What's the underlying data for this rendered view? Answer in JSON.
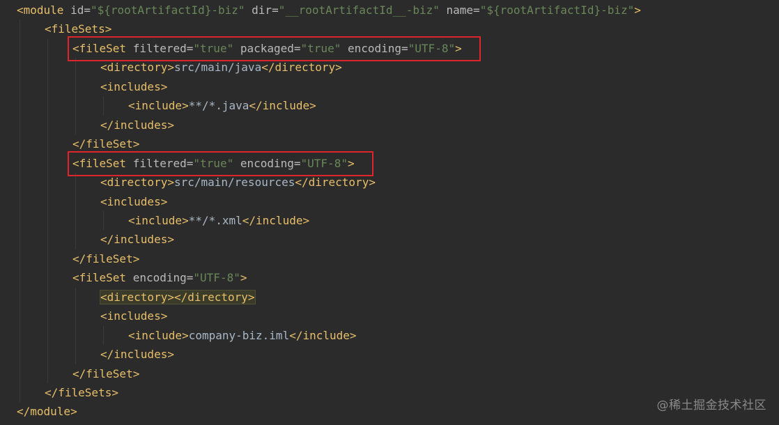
{
  "editor": {
    "lines": [
      {
        "indent": 0,
        "tokens": [
          {
            "t": "tag",
            "s": "<module "
          },
          {
            "t": "attr",
            "s": "id="
          },
          {
            "t": "val",
            "s": "\"${rootArtifactId}-biz\""
          },
          {
            "t": "attr",
            "s": " dir="
          },
          {
            "t": "val",
            "s": "\"__rootArtifactId__-biz\""
          },
          {
            "t": "attr",
            "s": " name="
          },
          {
            "t": "val",
            "s": "\"${rootArtifactId}-biz\""
          },
          {
            "t": "tag",
            "s": ">"
          }
        ]
      },
      {
        "indent": 1,
        "tokens": [
          {
            "t": "tag",
            "s": "<fileSets>"
          }
        ]
      },
      {
        "indent": 2,
        "tokens": [
          {
            "t": "tag",
            "s": "<fileSet "
          },
          {
            "t": "attr",
            "s": "filtered="
          },
          {
            "t": "val",
            "s": "\"true\""
          },
          {
            "t": "attr",
            "s": " packaged="
          },
          {
            "t": "val",
            "s": "\"true\""
          },
          {
            "t": "attr",
            "s": " encoding="
          },
          {
            "t": "val",
            "s": "\"UTF-8\""
          },
          {
            "t": "tag",
            "s": ">"
          }
        ]
      },
      {
        "indent": 3,
        "tokens": [
          {
            "t": "tag",
            "s": "<directory>"
          },
          {
            "t": "txt",
            "s": "src/main/java"
          },
          {
            "t": "tag",
            "s": "</directory>"
          }
        ]
      },
      {
        "indent": 3,
        "tokens": [
          {
            "t": "tag",
            "s": "<includes>"
          }
        ]
      },
      {
        "indent": 4,
        "tokens": [
          {
            "t": "tag",
            "s": "<include>"
          },
          {
            "t": "txt",
            "s": "**/*.java"
          },
          {
            "t": "tag",
            "s": "</include>"
          }
        ]
      },
      {
        "indent": 3,
        "tokens": [
          {
            "t": "tag",
            "s": "</includes>"
          }
        ]
      },
      {
        "indent": 2,
        "tokens": [
          {
            "t": "tag",
            "s": "</fileSet>"
          }
        ]
      },
      {
        "indent": 2,
        "tokens": [
          {
            "t": "tag",
            "s": "<fileSet "
          },
          {
            "t": "attr",
            "s": "filtered="
          },
          {
            "t": "val",
            "s": "\"true\""
          },
          {
            "t": "attr",
            "s": " encoding="
          },
          {
            "t": "val",
            "s": "\"UTF-8\""
          },
          {
            "t": "tag",
            "s": ">"
          }
        ]
      },
      {
        "indent": 3,
        "tokens": [
          {
            "t": "tag",
            "s": "<directory>"
          },
          {
            "t": "txt",
            "s": "src/main/resources"
          },
          {
            "t": "tag",
            "s": "</directory>"
          }
        ]
      },
      {
        "indent": 3,
        "tokens": [
          {
            "t": "tag",
            "s": "<includes>"
          }
        ]
      },
      {
        "indent": 4,
        "tokens": [
          {
            "t": "tag",
            "s": "<include>"
          },
          {
            "t": "txt",
            "s": "**/*.xml"
          },
          {
            "t": "tag",
            "s": "</include>"
          }
        ]
      },
      {
        "indent": 3,
        "tokens": [
          {
            "t": "tag",
            "s": "</includes>"
          }
        ]
      },
      {
        "indent": 2,
        "tokens": [
          {
            "t": "tag",
            "s": "</fileSet>"
          }
        ]
      },
      {
        "indent": 2,
        "tokens": [
          {
            "t": "tag",
            "s": "<fileSet "
          },
          {
            "t": "attr",
            "s": "encoding="
          },
          {
            "t": "val",
            "s": "\"UTF-8\""
          },
          {
            "t": "tag",
            "s": ">"
          }
        ]
      },
      {
        "indent": 3,
        "highlight": true,
        "tokens": [
          {
            "t": "tag",
            "s": "<directory></directory>"
          }
        ]
      },
      {
        "indent": 3,
        "tokens": [
          {
            "t": "tag",
            "s": "<includes>"
          }
        ]
      },
      {
        "indent": 4,
        "tokens": [
          {
            "t": "tag",
            "s": "<include>"
          },
          {
            "t": "txt",
            "s": "company-biz.iml"
          },
          {
            "t": "tag",
            "s": "</include>"
          }
        ]
      },
      {
        "indent": 3,
        "tokens": [
          {
            "t": "tag",
            "s": "</includes>"
          }
        ]
      },
      {
        "indent": 2,
        "tokens": [
          {
            "t": "tag",
            "s": "</fileSet>"
          }
        ]
      },
      {
        "indent": 1,
        "tokens": [
          {
            "t": "tag",
            "s": "</fileSets>"
          }
        ]
      },
      {
        "indent": 0,
        "tokens": [
          {
            "t": "tag",
            "s": "</module>"
          }
        ]
      }
    ],
    "highlighted_line_indices": [
      2,
      8
    ]
  },
  "watermark": "@稀土掘金技术社区",
  "colors": {
    "background": "#2b2b2b",
    "tag": "#e8bf6a",
    "attribute": "#bababa",
    "value": "#6a8759",
    "text": "#a9b7c6",
    "annotation_box": "#e0242c"
  }
}
